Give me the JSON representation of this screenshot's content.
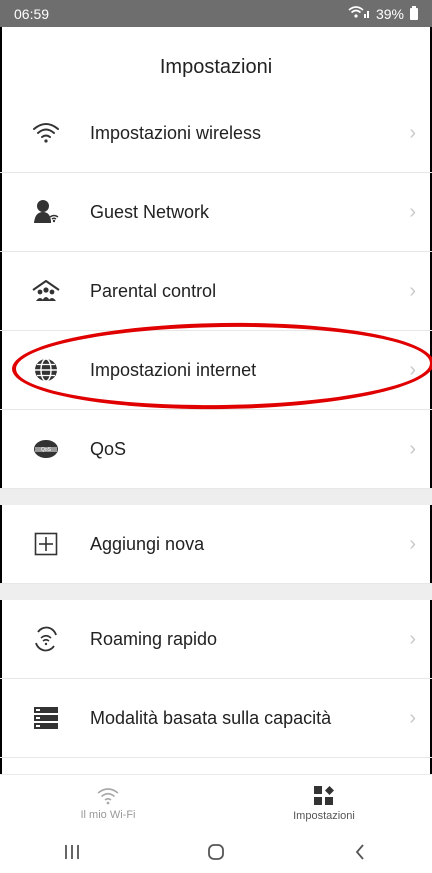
{
  "status": {
    "time": "06:59",
    "battery": "39%"
  },
  "header": {
    "title": "Impostazioni"
  },
  "settings": {
    "items": [
      {
        "label": "Impostazioni wireless",
        "icon": "wifi-icon"
      },
      {
        "label": "Guest Network",
        "icon": "guest-user-icon"
      },
      {
        "label": "Parental control",
        "icon": "family-home-icon"
      },
      {
        "label": "Impostazioni internet",
        "icon": "globe-icon"
      },
      {
        "label": "QoS",
        "icon": "qos-icon"
      }
    ],
    "group2": [
      {
        "label": "Aggiungi nova",
        "icon": "add-node-icon"
      }
    ],
    "group3": [
      {
        "label": "Roaming rapido",
        "icon": "fast-roaming-icon"
      },
      {
        "label": "Modalità basata sulla capacità",
        "icon": "capacity-mode-icon"
      }
    ]
  },
  "bottom_nav": {
    "mywifi": "Il mio Wi-Fi",
    "settings": "Impostazioni"
  },
  "annotation": {
    "highlight_color": "#e00000"
  }
}
